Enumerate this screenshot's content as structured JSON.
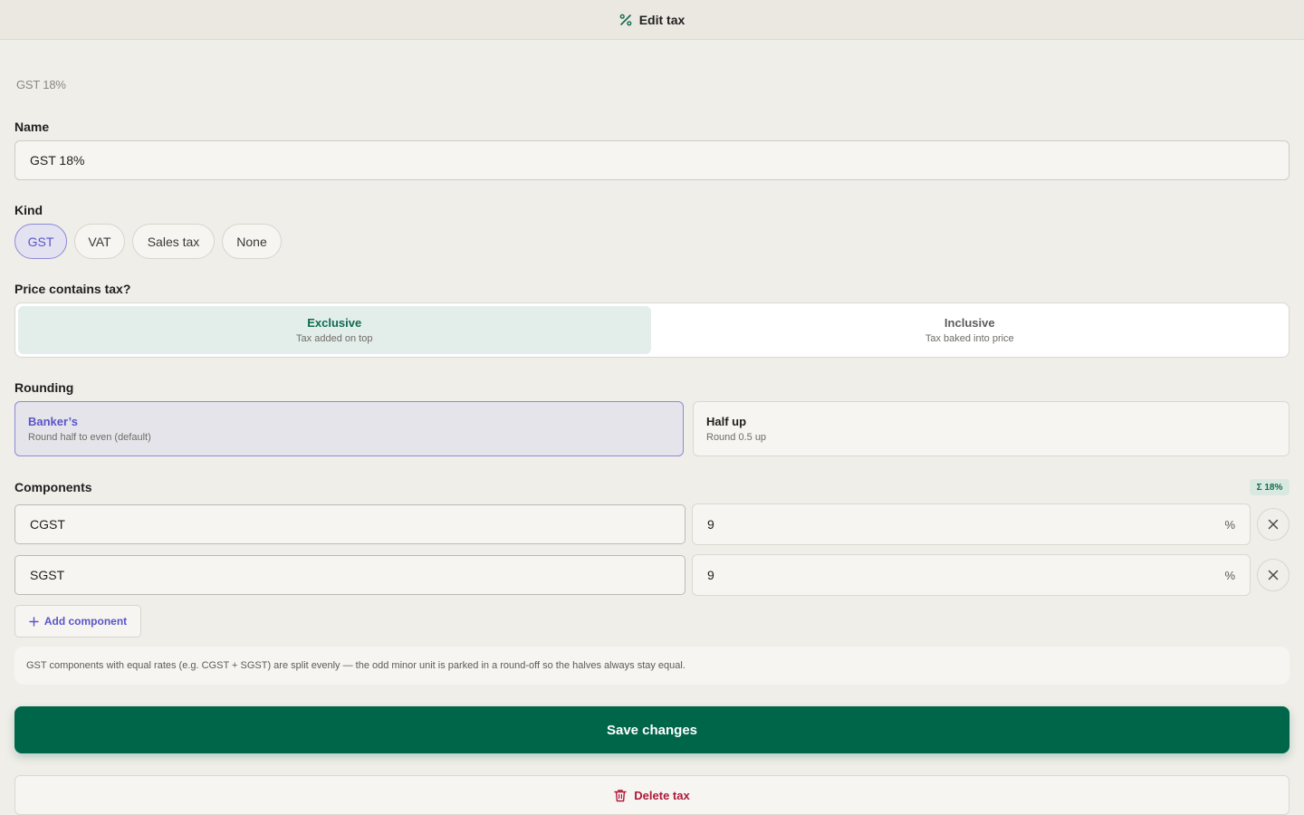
{
  "header": {
    "title": "Edit tax",
    "icon": "percent-icon",
    "icon_color": "#0e6b4e"
  },
  "subtitle": "GST 18%",
  "name_field": {
    "label": "Name",
    "value": "GST 18%"
  },
  "kind": {
    "label": "Kind",
    "options": [
      "GST",
      "VAT",
      "Sales tax",
      "None"
    ],
    "selected": "GST"
  },
  "price_contains": {
    "label": "Price contains tax?",
    "options": [
      {
        "title": "Exclusive",
        "sub": "Tax added on top"
      },
      {
        "title": "Inclusive",
        "sub": "Tax baked into price"
      }
    ],
    "selected": "Exclusive"
  },
  "rounding": {
    "label": "Rounding",
    "options": [
      {
        "title": "Banker’s",
        "sub": "Round half to even (default)"
      },
      {
        "title": "Half up",
        "sub": "Round 0.5 up"
      }
    ],
    "selected": "Banker’s"
  },
  "components": {
    "label": "Components",
    "total_badge": "Σ 18%",
    "rows": [
      {
        "name": "CGST",
        "rate": "9",
        "unit": "%"
      },
      {
        "name": "SGST",
        "rate": "9",
        "unit": "%"
      }
    ],
    "add_label": "Add component"
  },
  "note": "GST components with equal rates (e.g. CGST + SGST) are split evenly — the odd minor unit is parked in a round-off so the halves always stay equal.",
  "actions": {
    "save": "Save changes",
    "delete": "Delete tax"
  },
  "colors": {
    "accent": "#00664a",
    "selection": "#5a55c8",
    "danger": "#b0183a"
  }
}
